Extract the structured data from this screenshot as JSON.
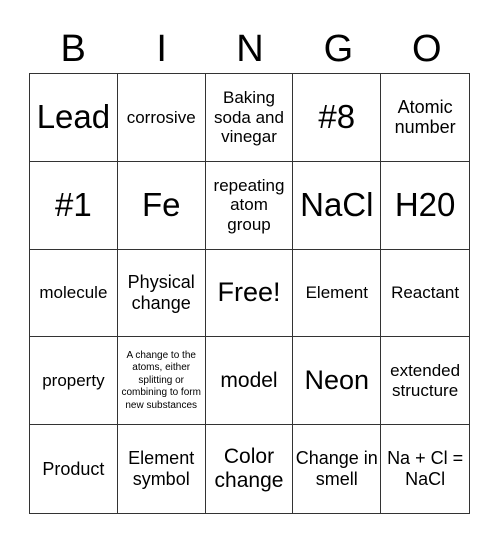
{
  "header": [
    "B",
    "I",
    "N",
    "G",
    "O"
  ],
  "cells": [
    {
      "text": "Lead",
      "size": "xl"
    },
    {
      "text": "corrosive",
      "size": "s"
    },
    {
      "text": "Baking soda and vinegar",
      "size": "s"
    },
    {
      "text": "#8",
      "size": "xl"
    },
    {
      "text": "Atomic number",
      "size": "n"
    },
    {
      "text": "#1",
      "size": "xl"
    },
    {
      "text": "Fe",
      "size": "xl"
    },
    {
      "text": "repeating atom group",
      "size": "s"
    },
    {
      "text": "NaCl",
      "size": "xl"
    },
    {
      "text": "H20",
      "size": "xl"
    },
    {
      "text": "molecule",
      "size": "s"
    },
    {
      "text": "Physical change",
      "size": "n"
    },
    {
      "text": "Free!",
      "size": "l"
    },
    {
      "text": "Element",
      "size": "s"
    },
    {
      "text": "Reactant",
      "size": "s"
    },
    {
      "text": "property",
      "size": "s"
    },
    {
      "text": "A change to the atoms, either splitting or combining to form new substances",
      "size": "xs"
    },
    {
      "text": "model",
      "size": "m"
    },
    {
      "text": "Neon",
      "size": "l"
    },
    {
      "text": "extended structure",
      "size": "s"
    },
    {
      "text": "Product",
      "size": "n"
    },
    {
      "text": "Element symbol",
      "size": "n"
    },
    {
      "text": "Color change",
      "size": "m"
    },
    {
      "text": "Change in smell",
      "size": "n"
    },
    {
      "text": "Na + Cl = NaCl",
      "size": "n"
    }
  ]
}
